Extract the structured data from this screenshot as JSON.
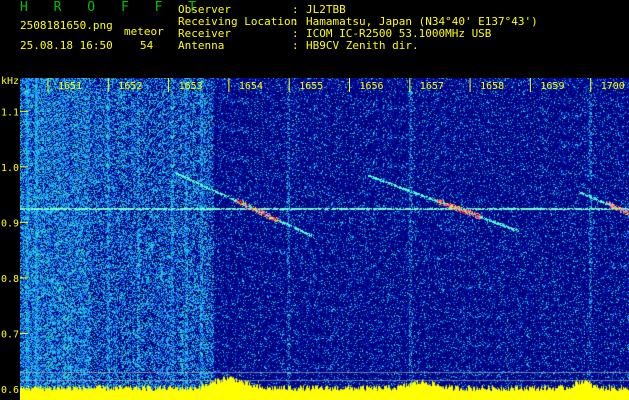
{
  "header": {
    "app_name": "H R O F F T",
    "filename": "2508181650.png",
    "datetime": "25.08.18 16:50",
    "meteor_label": "meteor",
    "meteor_count": "54",
    "info": [
      {
        "label": "Observer",
        "value": "JL2TBB"
      },
      {
        "label": "Receiving Location",
        "value": "Hamamatsu, Japan (N34°40' E137°43')"
      },
      {
        "label": "Receiver",
        "value": "ICOM IC-R2500 53.1000MHz USB"
      },
      {
        "label": "Antenna",
        "value": "HB9CV Zenith dir."
      }
    ]
  },
  "chart_data": {
    "type": "heatmap",
    "ylabel": "kHz",
    "x_ticks": [
      "1651",
      "1652",
      "1653",
      "1654",
      "1655",
      "1656",
      "1657",
      "1658",
      "1659",
      "1700"
    ],
    "y_ticks": [
      "1.1",
      "1.0",
      "0.9",
      "0.8",
      "0.7",
      "0.6"
    ],
    "ylim": [
      0.58,
      1.16
    ],
    "beacon_line_khz": 0.925,
    "meteor_traces": [
      {
        "t_start": "1652.1",
        "t_end": "1653.9",
        "f_start": 0.99,
        "f_end": 0.9
      },
      {
        "t_start": "1655.3",
        "t_end": "1657.3",
        "f_start": 0.985,
        "f_end": 0.905
      },
      {
        "t_start": "1658.8",
        "t_end": "1659.9",
        "f_start": 0.955,
        "f_end": 0.905
      }
    ],
    "colors": {
      "background": "#000080",
      "noise": "#1e90ff",
      "beacon": "#7fffd4",
      "peak": "#ff3030",
      "bottom_band": "#ffff00"
    }
  }
}
